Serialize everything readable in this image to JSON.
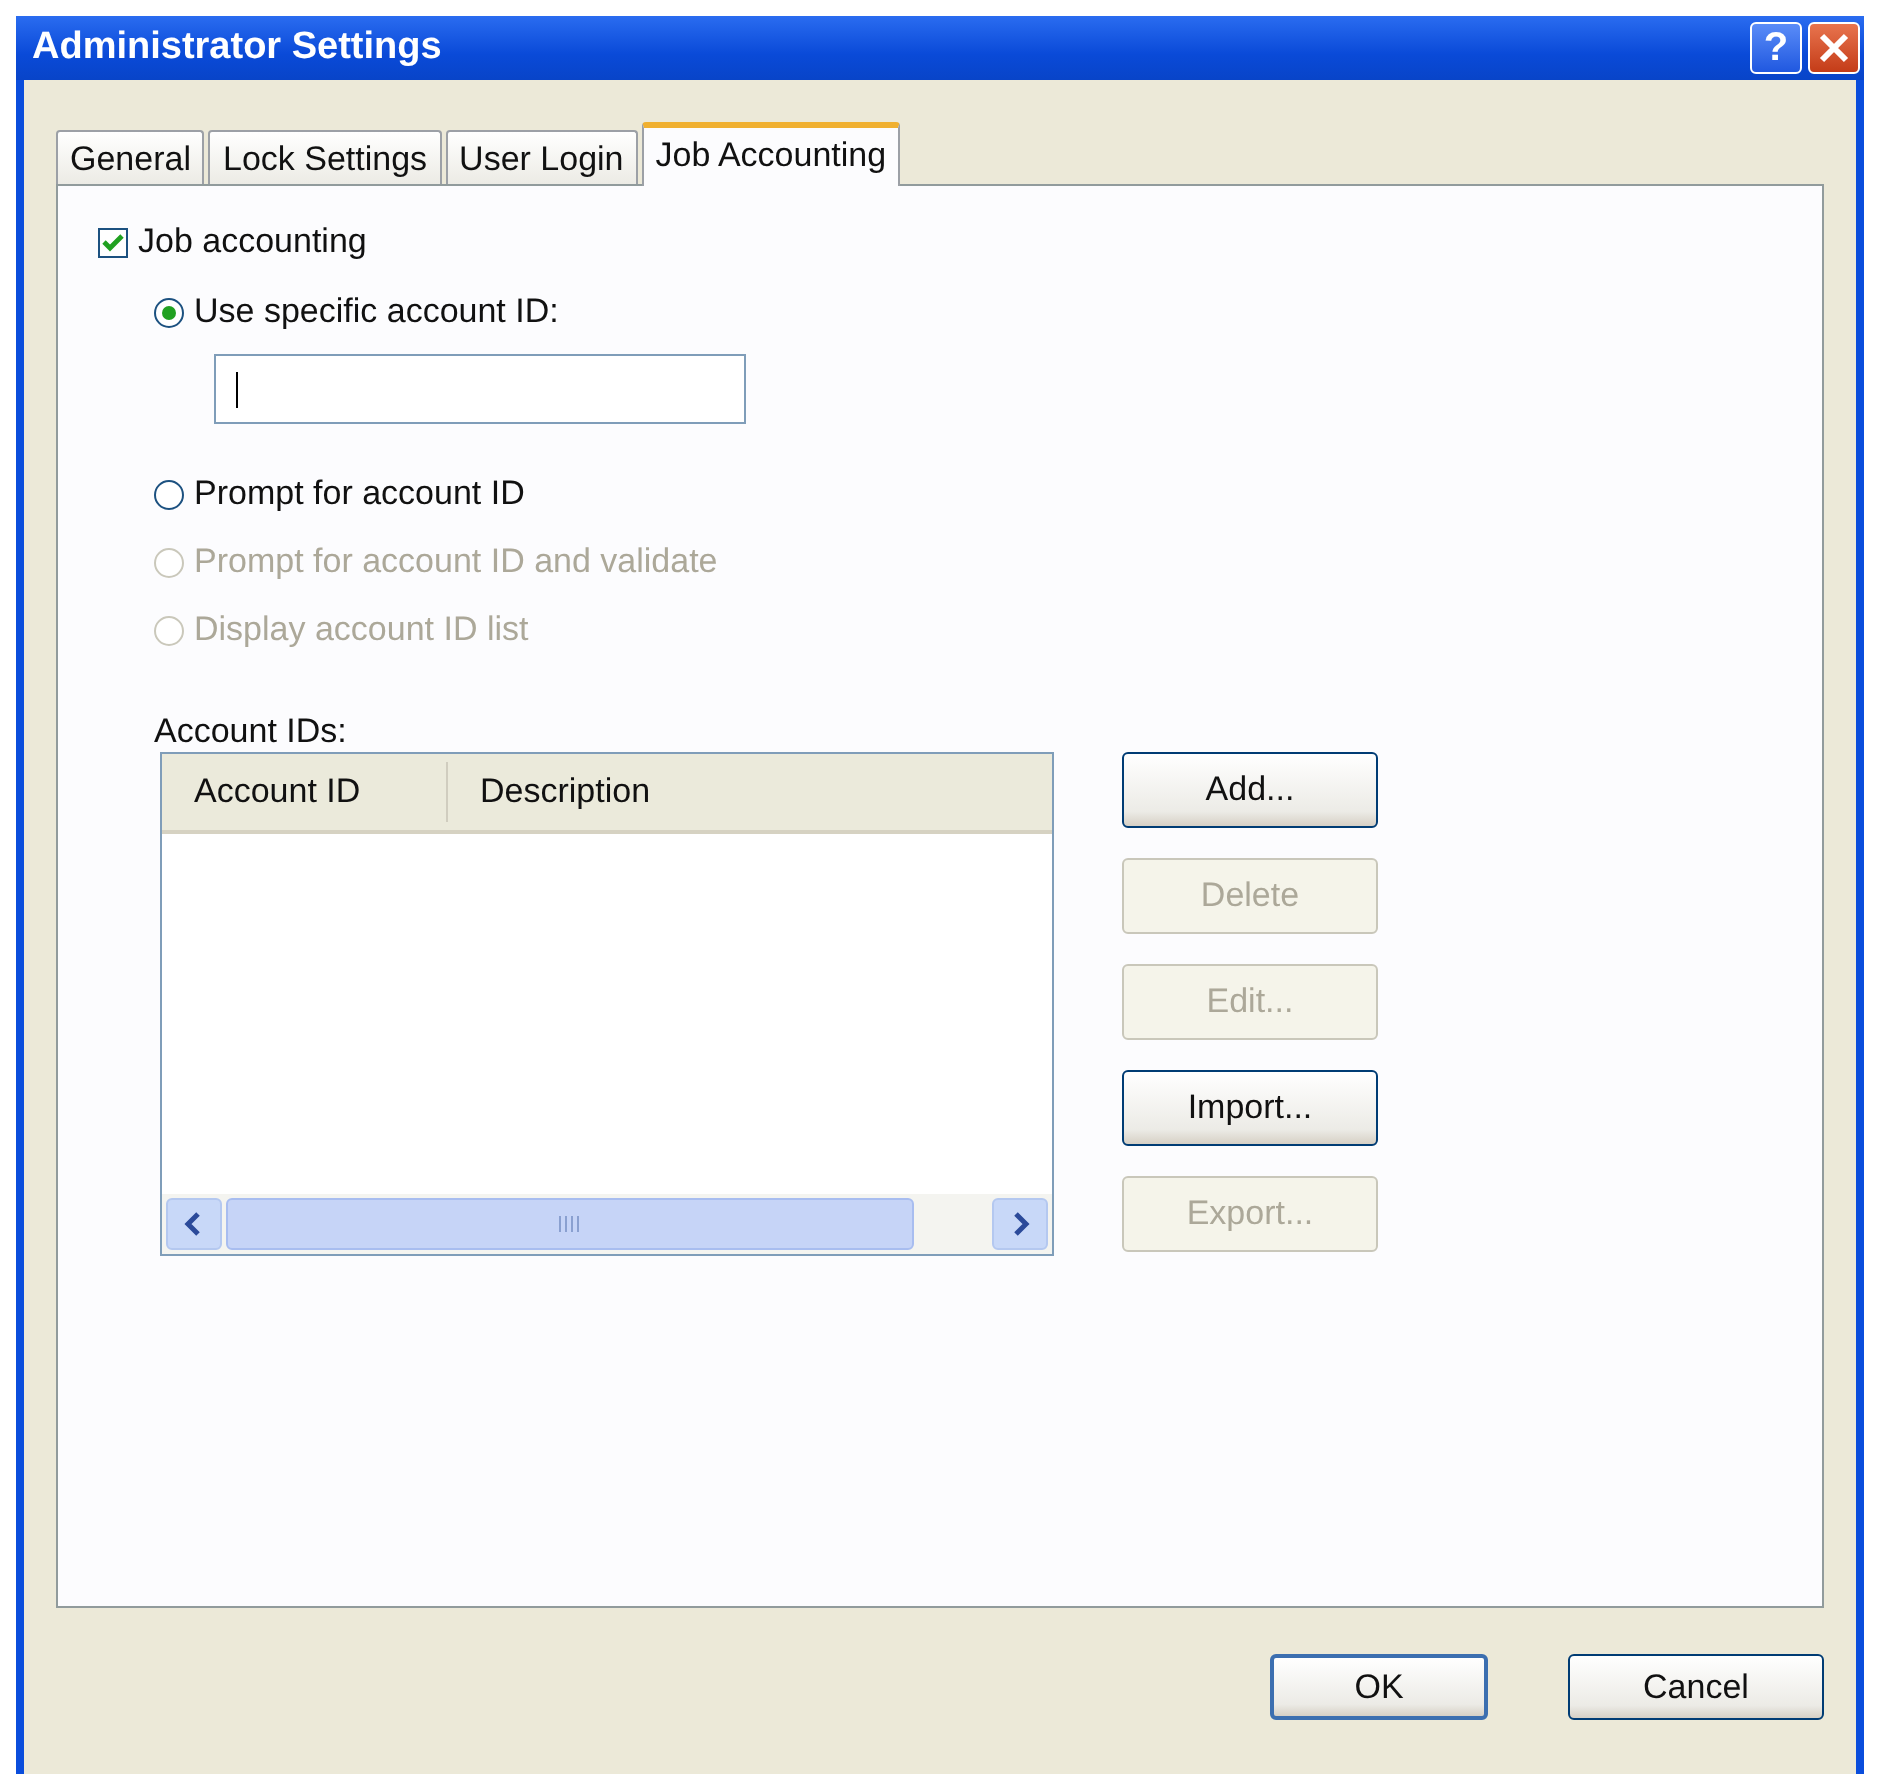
{
  "window": {
    "title": "Administrator Settings",
    "help_button": "?"
  },
  "tabs": [
    {
      "label": "General",
      "selected": false
    },
    {
      "label": "Lock Settings",
      "selected": false
    },
    {
      "label": "User Login",
      "selected": false
    },
    {
      "label": "Job Accounting",
      "selected": true
    }
  ],
  "job_accounting": {
    "label": "Job accounting",
    "checked": true
  },
  "options": [
    {
      "label": "Use specific account ID:",
      "selected": true,
      "disabled": false
    },
    {
      "label": "Prompt for account ID",
      "selected": false,
      "disabled": false
    },
    {
      "label": "Prompt for account ID and validate",
      "selected": false,
      "disabled": true
    },
    {
      "label": "Display account ID list",
      "selected": false,
      "disabled": true
    }
  ],
  "account_id_field": {
    "focused": true
  },
  "account_ids": {
    "label": "Account IDs:",
    "columns": [
      "Account ID",
      "Description"
    ]
  },
  "list_buttons": [
    {
      "label": "Add...",
      "disabled": false
    },
    {
      "label": "Delete",
      "disabled": true
    },
    {
      "label": "Edit...",
      "disabled": true
    },
    {
      "label": "Import...",
      "disabled": false
    },
    {
      "label": "Export...",
      "disabled": true
    }
  ],
  "dialog_buttons": [
    {
      "label": "OK",
      "default": true
    },
    {
      "label": "Cancel",
      "default": false
    }
  ]
}
